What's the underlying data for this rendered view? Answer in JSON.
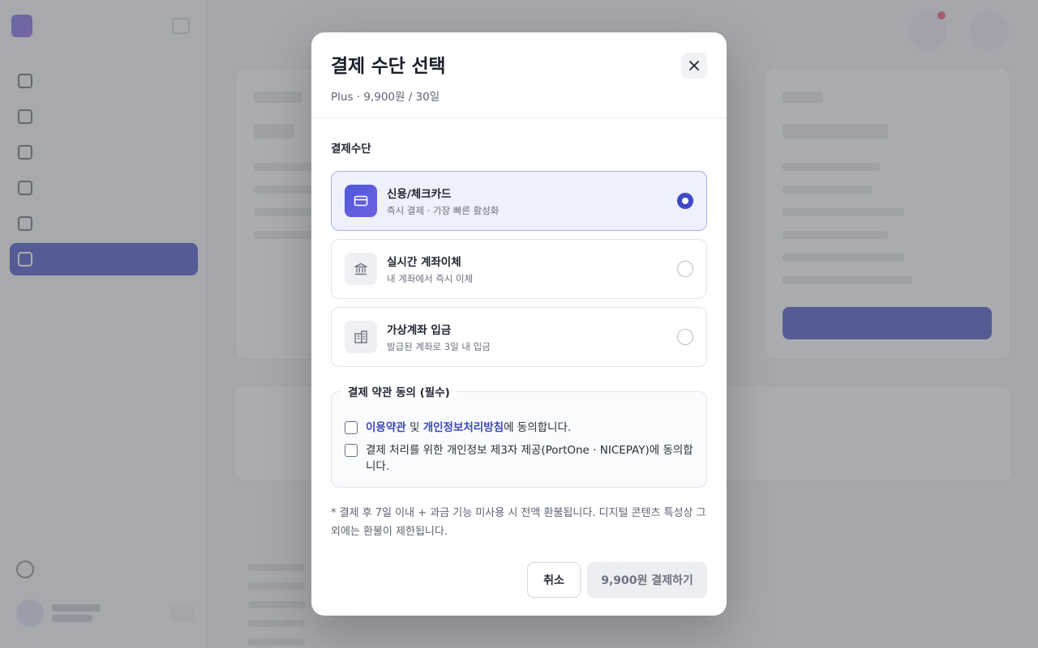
{
  "modal": {
    "title": "결제 수단 선택",
    "subtitle": "Plus · 9,900원 / 30일",
    "close_icon": "close-icon",
    "section_label": "결제수단",
    "payment_methods": [
      {
        "name": "신용/체크카드",
        "description": "즉시 결제 · 가장 빠른 활성화",
        "icon": "credit-card-icon",
        "selected": true
      },
      {
        "name": "실시간 계좌이체",
        "description": "내 계좌에서 즉시 이체",
        "icon": "bank-icon",
        "selected": false
      },
      {
        "name": "가상계좌 입금",
        "description": "발급된 계좌로 3일 내 입금",
        "icon": "building-icon",
        "selected": false
      }
    ],
    "terms": {
      "legend": "결제 약관 동의 (필수)",
      "terms_link": "이용약관",
      "and_text": " 및 ",
      "privacy_link": "개인정보처리방침",
      "agree_suffix": "에 동의합니다.",
      "third_party": "결제 처리를 위한 개인정보 제3자 제공(PortOne · NICEPAY)에 동의합니다."
    },
    "note": "* 결제 후 7일 이내 + 과금 기능 미사용 시 전액 환불됩니다. 디지털 콘텐츠 특성상 그 외에는 환불이 제한됩니다.",
    "cancel_label": "취소",
    "pay_label": "9,900원 결제하기"
  },
  "colors": {
    "accent": "#3d49c6",
    "overlay": "#6e7076",
    "link": "#3b4ab8"
  }
}
